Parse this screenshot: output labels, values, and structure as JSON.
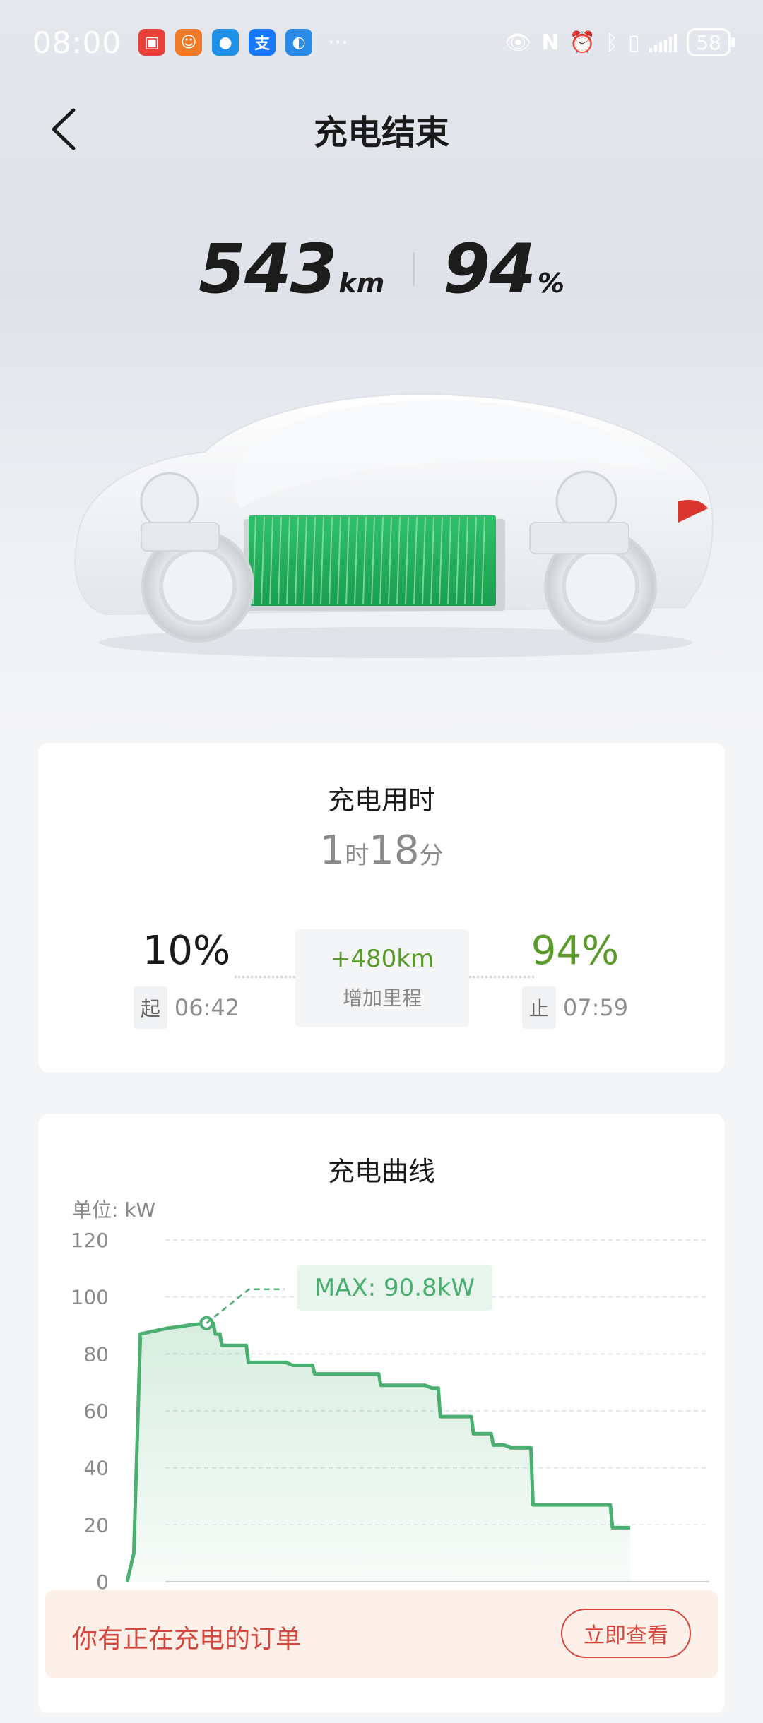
{
  "status_bar": {
    "time": "08:00",
    "battery": "58",
    "apps": [
      {
        "icon": "huawei-appgallery-icon",
        "color": "#e8413a",
        "glyph": "▣"
      },
      {
        "icon": "game-app-icon",
        "color": "#f07a2a",
        "glyph": "☺"
      },
      {
        "icon": "message-app-icon",
        "color": "#1e90e8",
        "glyph": "●"
      },
      {
        "icon": "alipay-icon",
        "color": "#1677ff",
        "glyph": "支"
      },
      {
        "icon": "browser-app-icon",
        "color": "#2a8ae8",
        "glyph": "◐"
      }
    ],
    "more": "···"
  },
  "header": {
    "title": "充电结束"
  },
  "headline": {
    "range_value": "543",
    "range_unit": "km",
    "soc_value": "94",
    "soc_unit": "%"
  },
  "duration_card": {
    "title": "充电用时",
    "hours": "1",
    "hours_unit": "时",
    "minutes": "18",
    "minutes_unit": "分",
    "start": {
      "soc": "10%",
      "tag": "起",
      "time": "06:42"
    },
    "end": {
      "soc": "94%",
      "tag": "止",
      "time": "07:59"
    },
    "added_range": "+480km",
    "added_range_label": "增加里程"
  },
  "curve_card": {
    "title": "充电曲线",
    "unit_label": "单位:  kW"
  },
  "chart_data": {
    "type": "area",
    "title": "充电曲线",
    "ylabel": "单位:  kW",
    "ylim": [
      0,
      120
    ],
    "y_ticks": [
      "0",
      "20",
      "40",
      "60",
      "80",
      "100",
      "120"
    ],
    "grid": true,
    "annotation": "MAX: 90.8kW",
    "max_value": 90.8,
    "color": "#4caf72",
    "series": [
      {
        "values": [
          0,
          10,
          87,
          87.5,
          88,
          88.5,
          89,
          89.3,
          89.6,
          90,
          90.3,
          90.5,
          90.8,
          87,
          83,
          83,
          83,
          83,
          77,
          77,
          77,
          77,
          77,
          77,
          77,
          76,
          76,
          76,
          73,
          73,
          73,
          73,
          73,
          73,
          73,
          73,
          73,
          73,
          69,
          69,
          69,
          69,
          69,
          69,
          69,
          69,
          68,
          58,
          58,
          58,
          58,
          58,
          52,
          52,
          52,
          48,
          48,
          48,
          47,
          47,
          47,
          27,
          27,
          27,
          27,
          27,
          27,
          27,
          27,
          27,
          27,
          27,
          27,
          19,
          19,
          19,
          19
        ]
      }
    ]
  },
  "order_banner": {
    "text": "你有正在充电的订单",
    "button": "立即查看"
  }
}
